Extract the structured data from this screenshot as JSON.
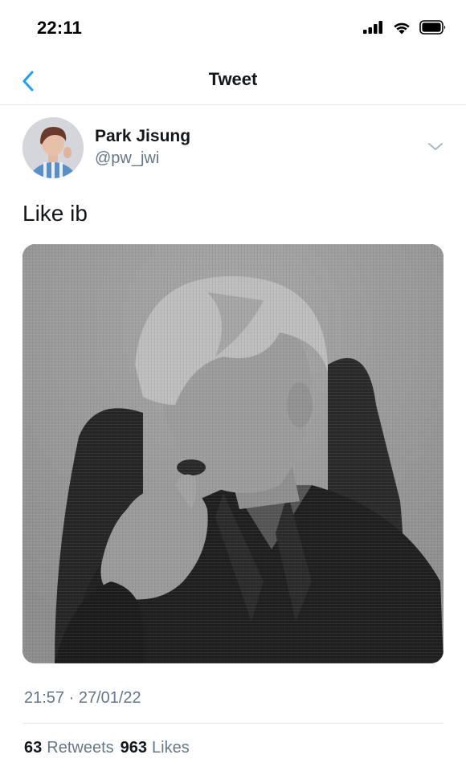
{
  "status_bar": {
    "time": "22:11",
    "icons": [
      "signal-icon",
      "wifi-icon",
      "battery-icon"
    ]
  },
  "nav": {
    "back_icon": "chevron-left-icon",
    "title": "Tweet"
  },
  "tweet": {
    "author": {
      "display_name": "Park Jisung",
      "handle": "@pw_jwi"
    },
    "text": "Like ib",
    "timestamp": "21:57 · 27/01/22",
    "stats": {
      "retweets_count": "63",
      "retweets_label": "Retweets",
      "likes_count": "963",
      "likes_label": "Likes"
    }
  },
  "colors": {
    "accent": "#1da1f2",
    "secondary_text": "#657786",
    "primary_text": "#14171a",
    "divider": "#e1e8ed"
  }
}
